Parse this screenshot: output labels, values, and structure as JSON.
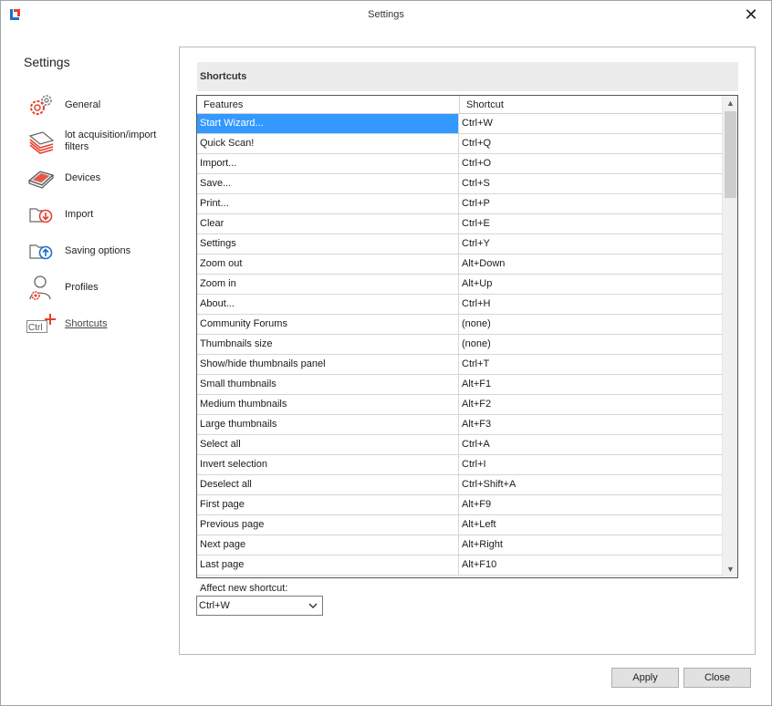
{
  "window": {
    "title": "Settings"
  },
  "sidebar": {
    "title": "Settings",
    "items": [
      {
        "label": "General",
        "icon": "gears-icon",
        "active": false
      },
      {
        "label": "lot acquisition/import filters",
        "icon": "paper-stack-icon",
        "active": false
      },
      {
        "label": "Devices",
        "icon": "scanner-icon",
        "active": false
      },
      {
        "label": "Import",
        "icon": "folder-import-icon",
        "active": false
      },
      {
        "label": "Saving options",
        "icon": "folder-save-icon",
        "active": false
      },
      {
        "label": "Profiles",
        "icon": "user-profile-icon",
        "active": false
      },
      {
        "label": "Shortcuts",
        "icon": "ctrl-plus-icon",
        "active": true
      }
    ]
  },
  "shortcuts": {
    "section_title": "Shortcuts",
    "columns": [
      "Features",
      "Shortcut"
    ],
    "selected_index": 0,
    "rows": [
      {
        "feature": "Start Wizard...",
        "shortcut": "Ctrl+W"
      },
      {
        "feature": "Quick Scan!",
        "shortcut": "Ctrl+Q"
      },
      {
        "feature": "Import...",
        "shortcut": "Ctrl+O"
      },
      {
        "feature": "Save...",
        "shortcut": "Ctrl+S"
      },
      {
        "feature": "Print...",
        "shortcut": "Ctrl+P"
      },
      {
        "feature": "Clear",
        "shortcut": "Ctrl+E"
      },
      {
        "feature": "Settings",
        "shortcut": "Ctrl+Y"
      },
      {
        "feature": "Zoom out",
        "shortcut": "Alt+Down"
      },
      {
        "feature": "Zoom in",
        "shortcut": "Alt+Up"
      },
      {
        "feature": "About...",
        "shortcut": "Ctrl+H"
      },
      {
        "feature": "Community Forums",
        "shortcut": "(none)"
      },
      {
        "feature": "Thumbnails size",
        "shortcut": "(none)"
      },
      {
        "feature": "Show/hide thumbnails panel",
        "shortcut": "Ctrl+T"
      },
      {
        "feature": "Small thumbnails",
        "shortcut": "Alt+F1"
      },
      {
        "feature": "Medium thumbnails",
        "shortcut": "Alt+F2"
      },
      {
        "feature": "Large thumbnails",
        "shortcut": "Alt+F3"
      },
      {
        "feature": "Select all",
        "shortcut": "Ctrl+A"
      },
      {
        "feature": "Invert selection",
        "shortcut": "Ctrl+I"
      },
      {
        "feature": "Deselect all",
        "shortcut": "Ctrl+Shift+A"
      },
      {
        "feature": "First page",
        "shortcut": "Alt+F9"
      },
      {
        "feature": "Previous page",
        "shortcut": "Alt+Left"
      },
      {
        "feature": "Next page",
        "shortcut": "Alt+Right"
      },
      {
        "feature": "Last page",
        "shortcut": "Alt+F10"
      }
    ],
    "affect_label": "Affect new shortcut:",
    "affect_value": "Ctrl+W"
  },
  "buttons": {
    "apply": "Apply",
    "close": "Close"
  },
  "colors": {
    "accent": "#e8402c",
    "blue": "#1c6fc7",
    "selection": "#3399ff"
  }
}
